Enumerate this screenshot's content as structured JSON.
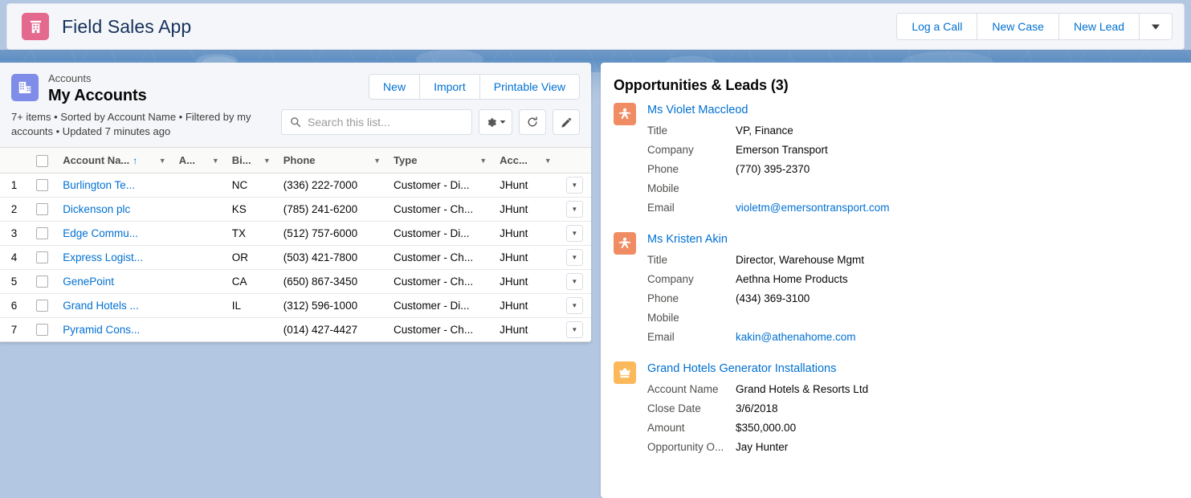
{
  "header": {
    "app_icon": "building-icon",
    "app_title": "Field Sales App",
    "actions": [
      {
        "label": "Log a Call",
        "name": "log-a-call-button"
      },
      {
        "label": "New Case",
        "name": "new-case-button"
      },
      {
        "label": "New Lead",
        "name": "new-lead-button"
      }
    ],
    "more_caret": "chevron-down-icon"
  },
  "list_panel": {
    "entity_icon": "accounts-icon",
    "eyebrow": "Accounts",
    "title": "My Accounts",
    "meta": "7+ items • Sorted by Account Name • Filtered by my accounts • Updated 7 minutes ago",
    "buttons": [
      {
        "label": "New",
        "name": "new-account-button"
      },
      {
        "label": "Import",
        "name": "import-button"
      },
      {
        "label": "Printable View",
        "name": "printable-view-button"
      }
    ],
    "search": {
      "placeholder": "Search this list...",
      "value": ""
    },
    "tools": [
      {
        "name": "list-settings-button",
        "icon": "gear-icon"
      },
      {
        "name": "refresh-button",
        "icon": "refresh-icon"
      },
      {
        "name": "edit-list-button",
        "icon": "pencil-icon"
      }
    ],
    "columns": [
      {
        "label": "Account Na...",
        "sorted": true,
        "sort_dir": "asc"
      },
      {
        "label": "A...",
        "sorted": false
      },
      {
        "label": "Bi...",
        "sorted": false
      },
      {
        "label": "Phone",
        "sorted": false
      },
      {
        "label": "Type",
        "sorted": false
      },
      {
        "label": "Acc...",
        "sorted": false
      }
    ],
    "sort_arrow": "↑",
    "rows": [
      {
        "num": "1",
        "name": "Burlington Te...",
        "a": "",
        "billing_state": "NC",
        "phone": "(336) 222-7000",
        "type": "Customer - Di...",
        "account_owner": "JHunt"
      },
      {
        "num": "2",
        "name": "Dickenson plc",
        "a": "",
        "billing_state": "KS",
        "phone": "(785) 241-6200",
        "type": "Customer - Ch...",
        "account_owner": "JHunt"
      },
      {
        "num": "3",
        "name": "Edge Commu...",
        "a": "",
        "billing_state": "TX",
        "phone": "(512) 757-6000",
        "type": "Customer - Di...",
        "account_owner": "JHunt"
      },
      {
        "num": "4",
        "name": "Express Logist...",
        "a": "",
        "billing_state": "OR",
        "phone": "(503) 421-7800",
        "type": "Customer - Ch...",
        "account_owner": "JHunt"
      },
      {
        "num": "5",
        "name": "GenePoint",
        "a": "",
        "billing_state": "CA",
        "phone": "(650) 867-3450",
        "type": "Customer - Ch...",
        "account_owner": "JHunt"
      },
      {
        "num": "6",
        "name": "Grand Hotels ...",
        "a": "",
        "billing_state": "IL",
        "phone": "(312) 596-1000",
        "type": "Customer - Di...",
        "account_owner": "JHunt"
      },
      {
        "num": "7",
        "name": "Pyramid Cons...",
        "a": "",
        "billing_state": "",
        "phone": "(014) 427-4427",
        "type": "Customer - Ch...",
        "account_owner": "JHunt"
      }
    ]
  },
  "detail_panel": {
    "title": "Opportunities & Leads (3)",
    "records": [
      {
        "icon": "lead-icon",
        "icon_kind": "lead",
        "name": "Ms Violet Maccleod",
        "fields": [
          {
            "label": "Title",
            "value": "VP, Finance",
            "link": false
          },
          {
            "label": "Company",
            "value": "Emerson Transport",
            "link": false
          },
          {
            "label": "Phone",
            "value": "(770) 395-2370",
            "link": false
          },
          {
            "label": "Mobile",
            "value": "",
            "link": false
          },
          {
            "label": "Email",
            "value": "violetm@emersontransport.com",
            "link": true
          }
        ]
      },
      {
        "icon": "lead-icon",
        "icon_kind": "lead",
        "name": "Ms Kristen Akin",
        "fields": [
          {
            "label": "Title",
            "value": "Director, Warehouse Mgmt",
            "link": false
          },
          {
            "label": "Company",
            "value": "Aethna Home Products",
            "link": false
          },
          {
            "label": "Phone",
            "value": "(434) 369-3100",
            "link": false
          },
          {
            "label": "Mobile",
            "value": "",
            "link": false
          },
          {
            "label": "Email",
            "value": "kakin@athenahome.com",
            "link": true
          }
        ]
      },
      {
        "icon": "opportunity-icon",
        "icon_kind": "opportunity",
        "name": "Grand Hotels Generator Installations",
        "fields": [
          {
            "label": "Account Name",
            "value": "Grand Hotels & Resorts Ltd",
            "link": false
          },
          {
            "label": "Close Date",
            "value": "3/6/2018",
            "link": false
          },
          {
            "label": "Amount",
            "value": "$350,000.00",
            "link": false
          },
          {
            "label": "Opportunity O...",
            "value": "Jay Hunter",
            "link": false
          }
        ]
      }
    ]
  },
  "colors": {
    "app_icon_bg": "#e4698f",
    "accounts_icon_bg": "#7f8ce8",
    "lead_icon_bg": "#f08c63",
    "opportunity_icon_bg": "#fcb95b",
    "link": "#0070d2",
    "backdrop": "#b3c7e2"
  }
}
